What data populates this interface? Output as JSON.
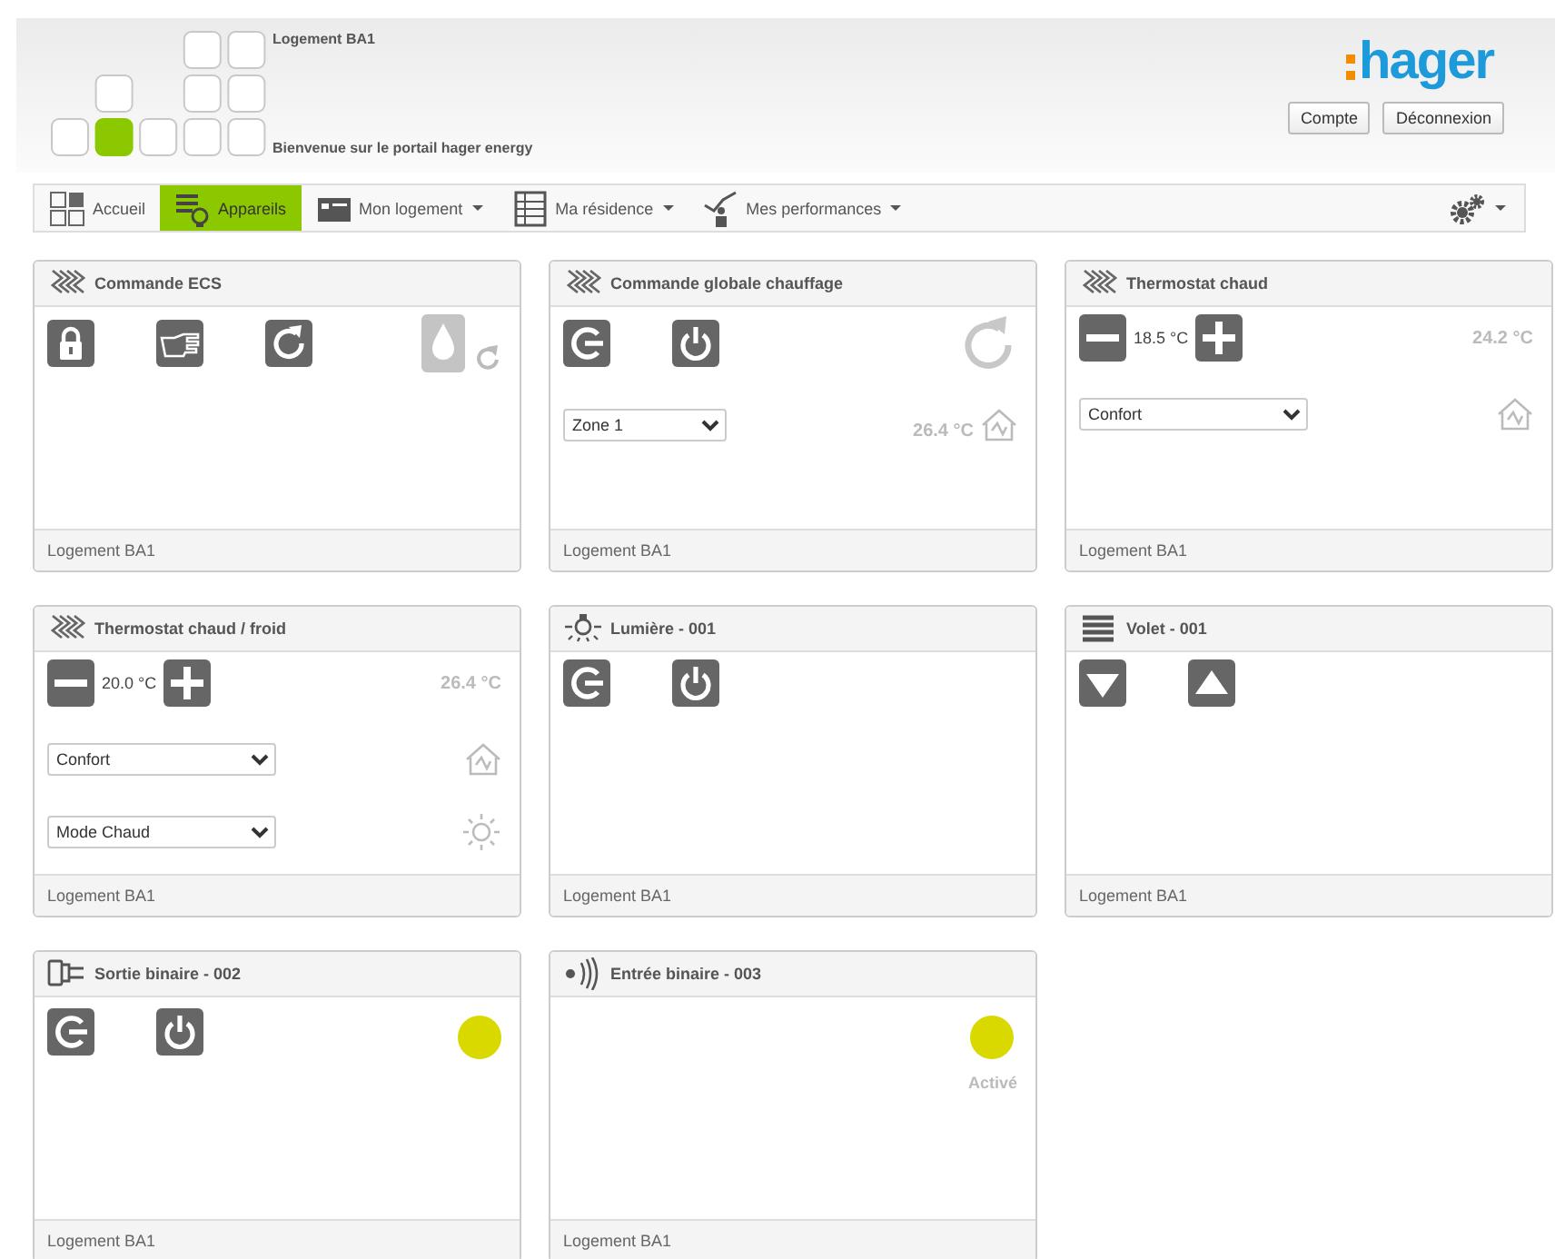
{
  "header": {
    "site": "Logement BA1",
    "welcome": "Bienvenue sur le portail hager energy",
    "logo": "hager",
    "buttons": [
      "Compte",
      "Déconnexion"
    ]
  },
  "nav": {
    "items": [
      {
        "kind": "home",
        "label": "Accueil",
        "selected": false,
        "dropdown": false
      },
      {
        "kind": "devices",
        "label": "Appareils",
        "selected": true,
        "dropdown": false
      },
      {
        "kind": "dwelling",
        "label": "Mon logement",
        "selected": false,
        "dropdown": true
      },
      {
        "kind": "residence",
        "label": "Ma résidence",
        "selected": false,
        "dropdown": true
      },
      {
        "kind": "performance",
        "label": "Mes performances",
        "selected": false,
        "dropdown": true
      }
    ],
    "settings": {
      "dropdown": true
    }
  },
  "cards": [
    {
      "kind": "heating",
      "title": "Commande ECS",
      "footer": "Logement BA1",
      "rows": [
        {
          "left": [
            {
              "kind": "lock"
            },
            {
              "kind": "hand"
            },
            {
              "kind": "refresh"
            }
          ],
          "right": [
            {
              "kind": "drop-state"
            },
            {
              "kind": "refresh-small"
            }
          ]
        }
      ]
    },
    {
      "kind": "heating",
      "title": "Commande globale chauffage",
      "footer": "Logement BA1",
      "rows": [
        {
          "left": [
            {
              "kind": "exit"
            },
            {
              "kind": "power"
            }
          ],
          "right": [
            {
              "kind": "refresh-state"
            }
          ]
        },
        {
          "left": [
            {
              "kind": "select",
              "value": "Zone 1"
            }
          ],
          "right": [
            {
              "kind": "reading",
              "text": "26.4 °C"
            },
            {
              "kind": "house"
            }
          ]
        }
      ]
    },
    {
      "kind": "heating",
      "title": "Thermostat chaud",
      "footer": "Logement BA1",
      "rows": [
        {
          "left": [
            {
              "kind": "minus"
            },
            {
              "kind": "value",
              "text": "18.5 °C"
            },
            {
              "kind": "plus"
            }
          ],
          "right": [
            {
              "kind": "reading",
              "text": "24.2 °C"
            }
          ]
        },
        {
          "left": [
            {
              "kind": "select",
              "value": "Confort"
            }
          ],
          "right": [
            {
              "kind": "house"
            }
          ]
        }
      ]
    },
    {
      "kind": "heating",
      "title": "Thermostat chaud / froid",
      "footer": "Logement BA1",
      "rows": [
        {
          "left": [
            {
              "kind": "minus"
            },
            {
              "kind": "value",
              "text": "20.0 °C"
            },
            {
              "kind": "plus"
            }
          ],
          "right": [
            {
              "kind": "reading",
              "text": "26.4 °C"
            }
          ]
        },
        {
          "left": [
            {
              "kind": "select",
              "value": "Confort"
            }
          ],
          "right": [
            {
              "kind": "house"
            }
          ]
        },
        {
          "left": [
            {
              "kind": "select",
              "value": "Mode Chaud"
            }
          ],
          "right": [
            {
              "kind": "sun"
            }
          ]
        }
      ]
    },
    {
      "kind": "light",
      "title": "Lumière - 001",
      "footer": "Logement BA1",
      "rows": [
        {
          "left": [
            {
              "kind": "exit"
            },
            {
              "kind": "power"
            }
          ],
          "right": []
        }
      ]
    },
    {
      "kind": "shutter",
      "title": "Volet - 001",
      "footer": "Logement BA1",
      "rows": [
        {
          "left": [
            {
              "kind": "down"
            },
            {
              "kind": "up"
            }
          ],
          "right": []
        }
      ]
    },
    {
      "kind": "output",
      "title": "Sortie binaire - 002",
      "footer": "Logement BA1",
      "rows": [
        {
          "left": [
            {
              "kind": "exit"
            },
            {
              "kind": "power"
            }
          ],
          "right": [
            {
              "kind": "dot",
              "color": "#d9d900"
            }
          ]
        }
      ]
    },
    {
      "kind": "input",
      "title": "Entrée binaire - 003",
      "footer": "Logement BA1",
      "rows": [
        {
          "left": [],
          "right": [
            {
              "kind": "dot",
              "color": "#d9d900",
              "caption": "Activé"
            }
          ]
        }
      ]
    }
  ]
}
